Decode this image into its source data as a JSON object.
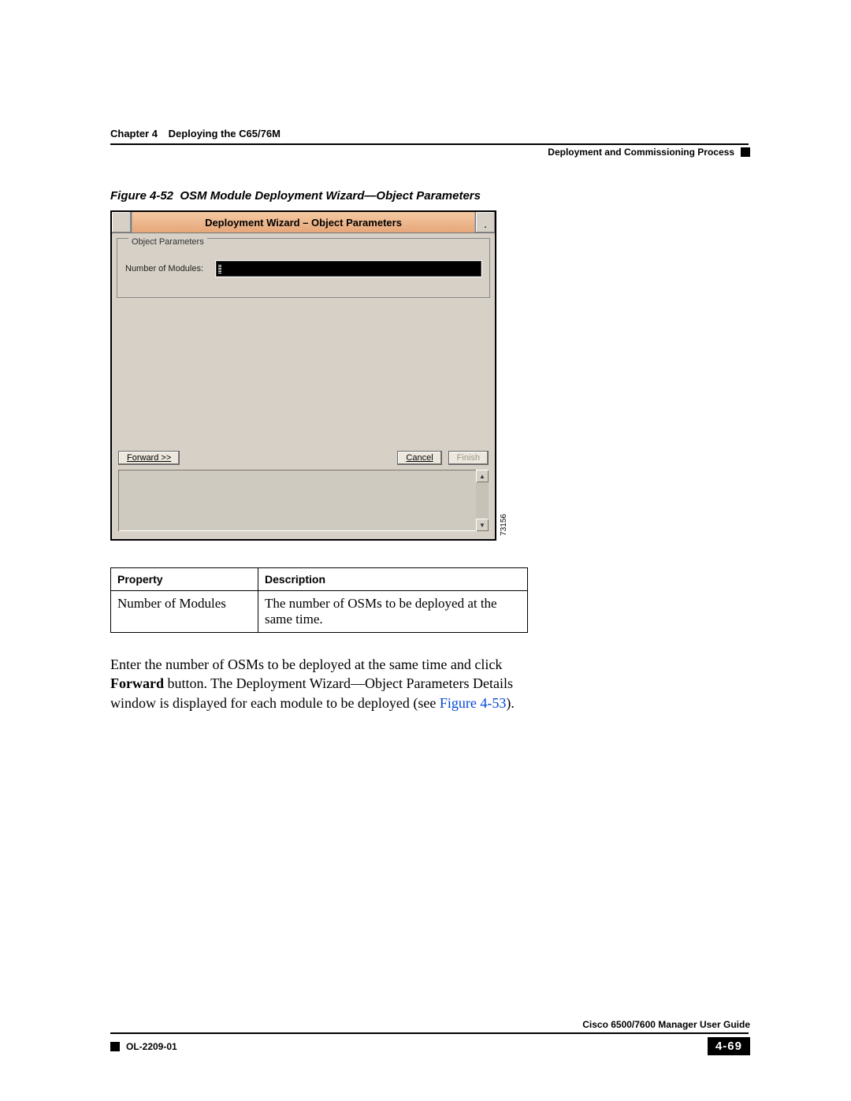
{
  "header": {
    "chapter_label": "Chapter 4",
    "chapter_title": "Deploying the C65/76M",
    "section_title": "Deployment and Commissioning Process"
  },
  "figure": {
    "caption_prefix": "Figure 4-52",
    "caption_title": "OSM Module Deployment Wizard—Object Parameters",
    "image_id": "73156"
  },
  "wizard": {
    "title": "Deployment Wizard – Object Parameters",
    "group_legend": "Object Parameters",
    "field_label": "Number of Modules:",
    "buttons": {
      "forward": "Forward >>",
      "cancel": "Cancel",
      "finish": "Finish"
    }
  },
  "table": {
    "headers": {
      "property": "Property",
      "description": "Description"
    },
    "rows": [
      {
        "property": "Number of Modules",
        "description": "The number of OSMs to be deployed at the same time."
      }
    ]
  },
  "paragraph": {
    "text_1": "Enter the number of OSMs to be deployed at the same time and click ",
    "forward_bold": "Forward",
    "text_2": " button. The Deployment Wizard—Object Parameters Details window is displayed for each module to be deployed (see ",
    "fig_ref": "Figure 4-53",
    "text_3": ")."
  },
  "footer": {
    "guide": "Cisco 6500/7600 Manager User Guide",
    "doc_id": "OL-2209-01",
    "page": "4-69"
  }
}
